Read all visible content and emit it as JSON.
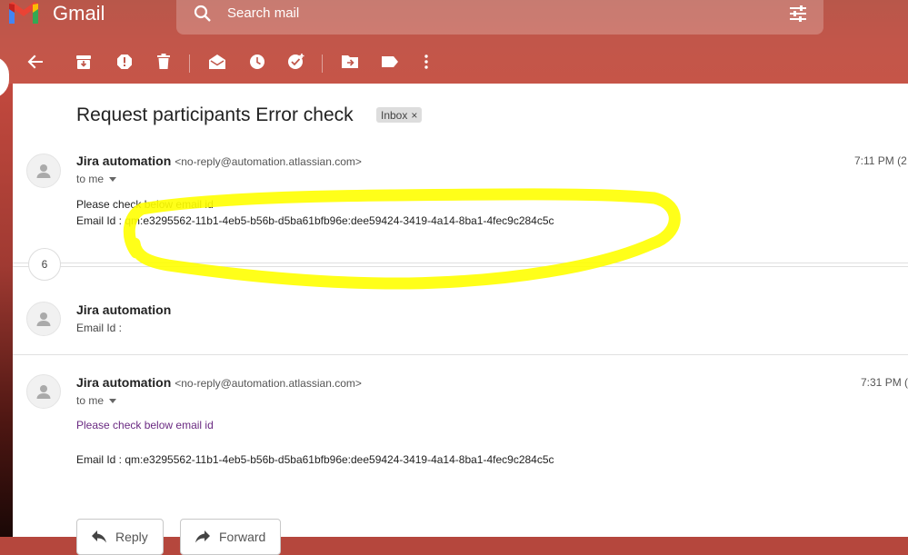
{
  "app": {
    "name": "Gmail"
  },
  "search": {
    "placeholder": "Search mail"
  },
  "thread": {
    "subject": "Request participants Error check",
    "label": "Inbox",
    "collapsed_count": "6"
  },
  "messages": [
    {
      "sender": "Jira automation",
      "address": "<no-reply@automation.atlassian.com>",
      "recipient": "to me",
      "time": "7:11 PM (2",
      "lines": [
        "Please check below email id",
        "Email Id : qm:e3295562-11b1-4eb5-b56b-d5ba61bfb96e:dee59424-3419-4a14-8ba1-4fec9c284c5c"
      ]
    },
    {
      "sender": "Jira automation",
      "snippet": "Email Id :"
    },
    {
      "sender": "Jira automation",
      "address": "<no-reply@automation.atlassian.com>",
      "recipient": "to me",
      "time": "7:31 PM (",
      "lines": [
        "Please check below email id",
        "Email Id : qm:e3295562-11b1-4eb5-b56b-d5ba61bfb96e:dee59424-3419-4a14-8ba1-4fec9c284c5c"
      ]
    }
  ],
  "actions": {
    "reply": "Reply",
    "forward": "Forward"
  },
  "colors": {
    "highlight": "#ffff00",
    "purple_text": "#6a2a82"
  }
}
